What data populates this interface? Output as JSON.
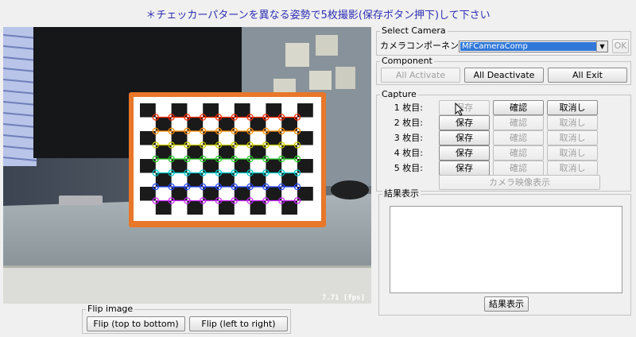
{
  "instruction": "＊チェッカーパターンを異なる姿勢で5枚撮影(保存ボタン押下)して下さい",
  "camera": {
    "fps": "7.71 [fps]"
  },
  "select_camera": {
    "legend": "Select Camera",
    "label": "カメラコンポーネント",
    "selected": "MFCameraComp",
    "ok_label": "OK"
  },
  "component": {
    "legend": "Component",
    "activate": "All Activate",
    "deactivate": "All Deactivate",
    "exit": "All Exit"
  },
  "capture": {
    "legend": "Capture",
    "rows": [
      {
        "label": "1 枚目:",
        "save": "保存",
        "confirm": "確認",
        "cancel": "取消し"
      },
      {
        "label": "2 枚目:",
        "save": "保存",
        "confirm": "確認",
        "cancel": "取消し"
      },
      {
        "label": "3 枚目:",
        "save": "保存",
        "confirm": "確認",
        "cancel": "取消し"
      },
      {
        "label": "4 枚目:",
        "save": "保存",
        "confirm": "確認",
        "cancel": "取消し"
      },
      {
        "label": "5 枚目:",
        "save": "保存",
        "confirm": "確認",
        "cancel": "取消し"
      }
    ],
    "show_camera": "カメラ映像表示"
  },
  "result": {
    "legend": "結果表示",
    "text": "",
    "button": "結果表示"
  },
  "flip": {
    "legend": "Flip image",
    "top_bottom": "Flip (top to bottom)",
    "left_right": "Flip (left to right)"
  },
  "colors": {
    "instruction": "#2d2db4",
    "selection": "#3078d8",
    "chessboard_frame": "#e8772a",
    "corner_rows": [
      "#ff2a00",
      "#ff8c00",
      "#c8c800",
      "#28c828",
      "#00c8c8",
      "#2848ff",
      "#c828ff",
      "#ff8c28"
    ]
  }
}
